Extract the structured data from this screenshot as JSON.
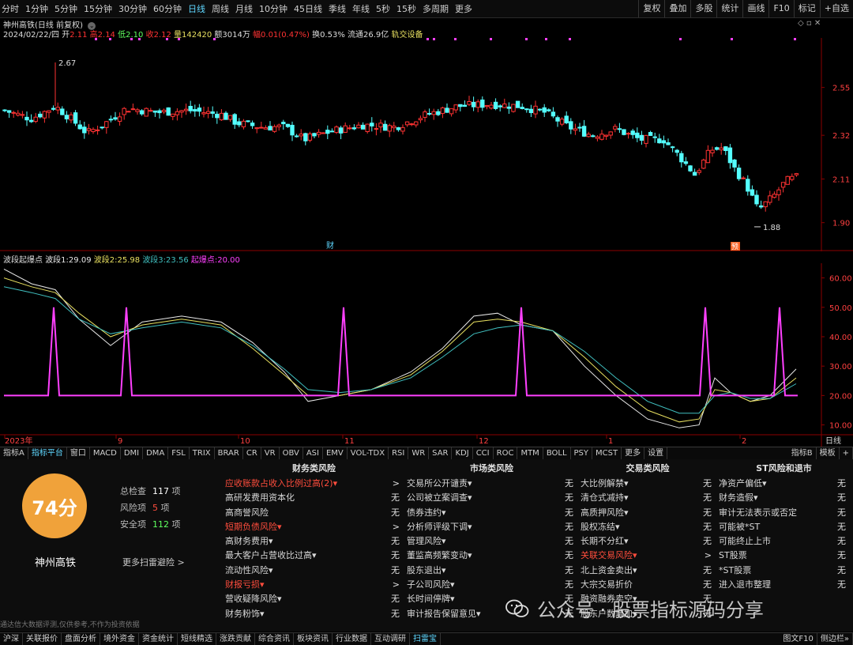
{
  "toolbar": {
    "periods": [
      "分时",
      "1分钟",
      "5分钟",
      "15分钟",
      "30分钟",
      "60分钟",
      "日线",
      "周线",
      "月线",
      "10分钟",
      "45日线",
      "季线",
      "年线",
      "5秒",
      "15秒",
      "多周期",
      "更多"
    ],
    "active_period": "日线",
    "right_buttons": [
      "复权",
      "叠加",
      "多股",
      "统计",
      "画线",
      "F10",
      "标记",
      "+自选"
    ]
  },
  "stock": {
    "title": "神州高铁(日线 前复权)",
    "date": "2024/02/22/四",
    "open_label": "开",
    "open": "2.11",
    "high_label": "高",
    "high": "2.14",
    "low_label": "低",
    "low": "2.10",
    "close_label": "收",
    "close": "2.12",
    "vol_label": "量",
    "vol": "142420",
    "amount_label": "额",
    "amount": "3014万",
    "change_label": "幅",
    "change": "0.01(0.47%)",
    "turnover_label": "换",
    "turnover": "0.53%",
    "float_label": "流通",
    "float": "26.9亿",
    "concept": "轨交设备",
    "max_label": "2.67",
    "min_label": "1.88",
    "marker_cai": "财",
    "marker_yu": "预"
  },
  "indicator": {
    "name": "波段起爆点",
    "b1_label": "波段1:",
    "b1": "29.09",
    "b2_label": "波段2:",
    "b2": "25.98",
    "b3_label": "波段3:",
    "b3": "23.56",
    "qb_label": "起爆点:",
    "qb": "20.00"
  },
  "colors": {
    "up": "#ff3232",
    "down": "#54ffff",
    "b1": "#e8e8e8",
    "b2": "#e8e060",
    "b3": "#40c0c0",
    "qb": "#ff40ff"
  },
  "chart_data": [
    {
      "type": "candlestick",
      "ylim": [
        1.8,
        2.75
      ],
      "yticks": [
        "2.55",
        "2.32",
        "2.11",
        "1.90"
      ]
    },
    {
      "type": "line",
      "ylim": [
        8,
        65
      ],
      "yticks": [
        "60.00",
        "50.00",
        "40.00",
        "30.00",
        "20.00",
        "10.00"
      ],
      "xticks": [
        "2023年",
        "9",
        "10",
        "11",
        "12",
        "1",
        "2"
      ],
      "series": [
        {
          "name": "波段1",
          "color": "#e8e8e8"
        },
        {
          "name": "波段2",
          "color": "#e8e060"
        },
        {
          "name": "波段3",
          "color": "#40c0c0"
        },
        {
          "name": "起爆点",
          "color": "#ff40ff"
        }
      ],
      "spike_positions_x": [
        68,
        160,
        435,
        660,
        893,
        987
      ],
      "spike_high": 50,
      "spike_base": 20
    }
  ],
  "xaxis_right": "日线",
  "tabs": [
    "指标A",
    "指标平台",
    "窗口",
    "MACD",
    "DMI",
    "DMA",
    "FSL",
    "TRIX",
    "BRAR",
    "CR",
    "VR",
    "OBV",
    "ASI",
    "EMV",
    "VOL-TDX",
    "RSI",
    "WR",
    "SAR",
    "KDJ",
    "CCI",
    "ROC",
    "MTM",
    "BOLL",
    "PSY",
    "MCST",
    "更多",
    "设置"
  ],
  "tabs_active": "指标平台",
  "tabs_right": [
    "指标B",
    "模板",
    "+"
  ],
  "scan": {
    "score": "74分",
    "company": "神州高铁",
    "total_label": "总检查",
    "total": "117",
    "unit": "项",
    "risk_label": "风险项",
    "risk": "5",
    "safe_label": "安全项",
    "safe": "112",
    "more": "更多扫雷避险 >",
    "disclaimer": "通达信大数据评测,仅供参考,不作为投资依据",
    "columns": [
      {
        "title": "财务类风险",
        "rows": [
          {
            "label": "应收账款占收入比例过高(2)▾",
            "result": ">",
            "red": true
          },
          {
            "label": "高研发费用资本化",
            "result": "无",
            "red": false
          },
          {
            "label": "高商誉风险",
            "result": "无",
            "red": false
          },
          {
            "label": "短期负债风险▾",
            "result": ">",
            "red": true
          },
          {
            "label": "高财务费用▾",
            "result": "无",
            "red": false
          },
          {
            "label": "最大客户占营收比过高▾",
            "result": "无",
            "red": false
          },
          {
            "label": "流动性风险▾",
            "result": "无",
            "red": false
          },
          {
            "label": "财报亏损▾",
            "result": ">",
            "red": true
          },
          {
            "label": "营收疑降风险▾",
            "result": "无",
            "red": false
          },
          {
            "label": "财务粉饰▾",
            "result": "无",
            "red": false
          }
        ]
      },
      {
        "title": "市场类风险",
        "rows": [
          {
            "label": "交易所公开谴责▾",
            "result": "无",
            "red": false
          },
          {
            "label": "公司被立案调查▾",
            "result": "无",
            "red": false
          },
          {
            "label": "债券违约▾",
            "result": "无",
            "red": false
          },
          {
            "label": "分析师评级下调▾",
            "result": "无",
            "red": false
          },
          {
            "label": "管理风险▾",
            "result": "无",
            "red": false
          },
          {
            "label": "董监高频繁变动▾",
            "result": "无",
            "red": false
          },
          {
            "label": "股东退出▾",
            "result": "无",
            "red": false
          },
          {
            "label": "子公司风险▾",
            "result": "无",
            "red": false
          },
          {
            "label": "长时间停牌▾",
            "result": "无",
            "red": false
          },
          {
            "label": "审计报告保留意见▾",
            "result": "无",
            "red": false
          }
        ]
      },
      {
        "title": "交易类风险",
        "rows": [
          {
            "label": "大比例解禁▾",
            "result": "无",
            "red": false
          },
          {
            "label": "清仓式减持▾",
            "result": "无",
            "red": false
          },
          {
            "label": "高质押风险▾",
            "result": "无",
            "red": false
          },
          {
            "label": "股权冻结▾",
            "result": "无",
            "red": false
          },
          {
            "label": "长期不分红▾",
            "result": "无",
            "red": false
          },
          {
            "label": "关联交易风险▾",
            "result": ">",
            "red": true
          },
          {
            "label": "北上资金卖出▾",
            "result": "无",
            "red": false
          },
          {
            "label": "大宗交易折价",
            "result": "无",
            "red": false
          },
          {
            "label": "融资融券卖空▾",
            "result": "无",
            "red": false
          },
          {
            "label": "股东户数增加▾",
            "result": "无",
            "red": false
          }
        ]
      },
      {
        "title": "ST风险和退市",
        "rows": [
          {
            "label": "净资产偏低▾",
            "result": "无",
            "red": false
          },
          {
            "label": "财务造假▾",
            "result": "无",
            "red": false
          },
          {
            "label": "审计无法表示或否定",
            "result": "无",
            "red": false
          },
          {
            "label": "可能被*ST",
            "result": "无",
            "red": false
          },
          {
            "label": "可能终止上市",
            "result": "无",
            "red": false
          },
          {
            "label": "ST股票",
            "result": "无",
            "red": false
          },
          {
            "label": "*ST股票",
            "result": "无",
            "red": false
          },
          {
            "label": "进入退市整理",
            "result": "无",
            "red": false
          }
        ]
      }
    ]
  },
  "bottom_tabs": [
    "沪深",
    "关联报价",
    "盘面分析",
    "境外资金",
    "资金统计",
    "短线精选",
    "涨跌贡献",
    "综合资讯",
    "板块资讯",
    "行业数据",
    "互动调研",
    "扫雷宝"
  ],
  "bottom_active": "扫雷宝",
  "bottom_right": [
    "图文F10",
    "侧边栏»"
  ],
  "watermark": "公众号 · 股票指标源码分享"
}
